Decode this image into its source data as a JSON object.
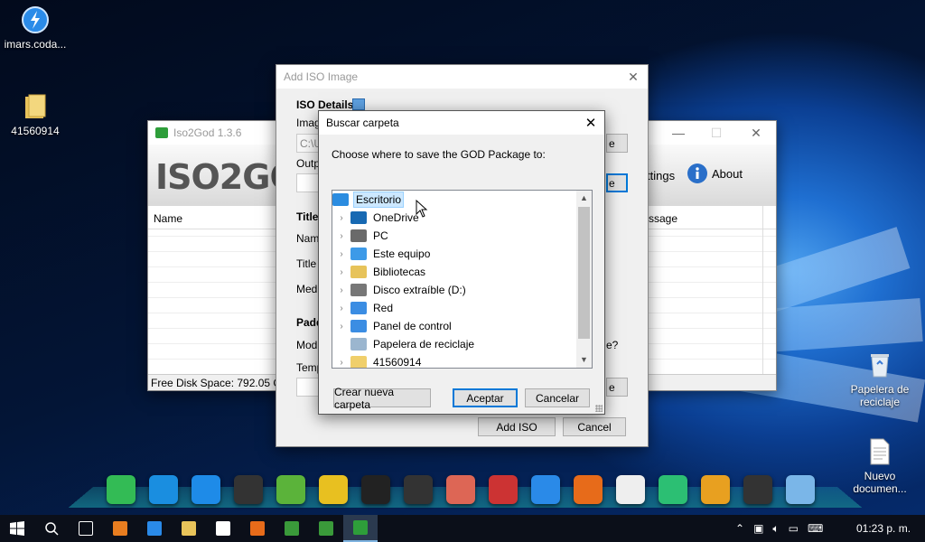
{
  "desktop_icons": [
    {
      "label": "imars.coda...",
      "icon": "daemon-tools-icon"
    },
    {
      "label": "41560914",
      "icon": "folder-icon"
    },
    {
      "label": "Papelera de reciclaje",
      "icon": "recycle-bin-icon"
    },
    {
      "label": "Nuevo documen...",
      "icon": "text-document-icon"
    }
  ],
  "iso2god": {
    "title": "Iso2God 1.3.6",
    "logo": "ISO2GO",
    "col_name": "Name",
    "col_message": "ssage",
    "settings_label": "ttings",
    "about_label": "About",
    "free_space": "Free Disk Space: 792.05 GB"
  },
  "add_iso": {
    "title": "Add ISO Image",
    "iso_details": "ISO Details",
    "image_label": "Imag",
    "image_value": "C:\\U",
    "output_label": "Outp",
    "title_section": "Title",
    "name_label": "Nam",
    "title_label": "Title",
    "media_label": "Med",
    "padding_section": "Padd",
    "mode_label": "Mod",
    "temp_label": "Temp",
    "mode_question": "e?",
    "btn_e1": "e",
    "btn_e2": "e",
    "btn_e3": "e",
    "add_iso_button": "Add ISO",
    "cancel_button": "Cancel"
  },
  "folder_dialog": {
    "title": "Buscar carpeta",
    "prompt": "Choose where to save the GOD Package to:",
    "items": [
      {
        "label": "Escritorio",
        "icon": "desktop-folder-icon",
        "selected": true,
        "expandable": false
      },
      {
        "label": "OneDrive",
        "icon": "onedrive-icon",
        "expandable": true
      },
      {
        "label": "PC",
        "icon": "user-icon",
        "expandable": true
      },
      {
        "label": "Este equipo",
        "icon": "computer-icon",
        "expandable": true
      },
      {
        "label": "Bibliotecas",
        "icon": "libraries-icon",
        "expandable": true
      },
      {
        "label": "Disco extraíble (D:)",
        "icon": "removable-drive-icon",
        "expandable": true
      },
      {
        "label": "Red",
        "icon": "network-icon",
        "expandable": true
      },
      {
        "label": "Panel de control",
        "icon": "control-panel-icon",
        "expandable": true
      },
      {
        "label": "Papelera de reciclaje",
        "icon": "recycle-bin-icon",
        "expandable": false
      },
      {
        "label": "41560914",
        "icon": "folder-icon",
        "expandable": true
      }
    ],
    "new_folder_button": "Crear nueva carpeta",
    "accept_button": "Aceptar",
    "cancel_button": "Cancelar"
  },
  "dock_icons": [
    "nexus-icon",
    "windows7-icon",
    "daemon-icon",
    "steam-icon",
    "utorrent-icon",
    "geometry-dash-icon",
    "need-for-speed-icon",
    "black-ops-icon",
    "black-ops-2-icon",
    "black-ops-3-icon",
    "daemon-tools-icon",
    "firefox-icon",
    "notepad-icon",
    "paper-plane-icon",
    "killer-instinct-icon",
    "camera-icon",
    "image-icon"
  ],
  "taskbar": {
    "icons": [
      "start-icon",
      "search-icon",
      "task-view-icon",
      "media-player-icon",
      "edge-icon",
      "file-explorer-icon",
      "store-icon",
      "firefox-icon",
      "camtasia-icon",
      "camtasia-2-icon",
      "iso2god-icon"
    ],
    "clock": "01:23 p. m."
  }
}
